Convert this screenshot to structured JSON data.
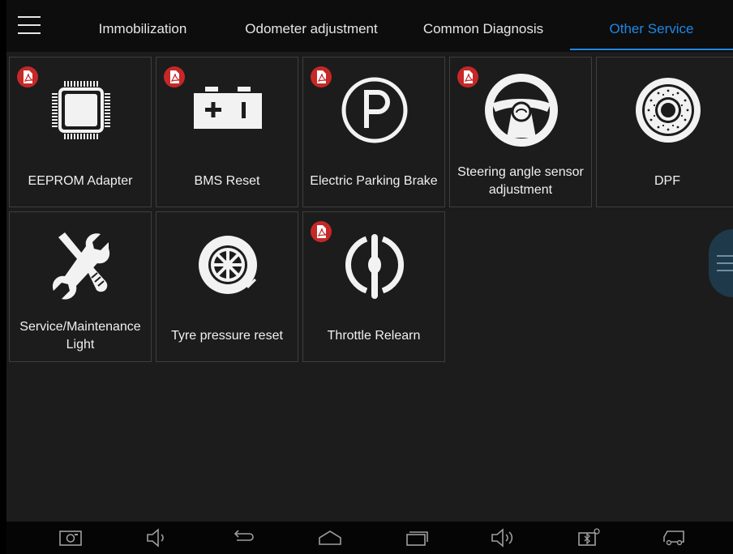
{
  "tabs": [
    {
      "label": "Immobilization",
      "active": false
    },
    {
      "label": "Odometer adjustment",
      "active": false
    },
    {
      "label": "Common Diagnosis",
      "active": false
    },
    {
      "label": "Other Service",
      "active": true
    }
  ],
  "colors": {
    "accent": "#1e88e5",
    "background": "#1c1c1c",
    "tile_border": "#3e3e3e",
    "pdf_badge": "#c62828"
  },
  "tiles": [
    {
      "label": "EEPROM Adapter",
      "icon": "chip-icon",
      "has_pdf": true
    },
    {
      "label": "BMS Reset",
      "icon": "battery-icon",
      "has_pdf": true
    },
    {
      "label": "Electric Parking Brake",
      "icon": "parking-brake-icon",
      "has_pdf": true
    },
    {
      "label": "Steering angle sensor adjustment",
      "icon": "steering-wheel-icon",
      "has_pdf": true
    },
    {
      "label": "DPF",
      "icon": "dpf-filter-icon",
      "has_pdf": false
    },
    {
      "label": "Service/Maintenance Light",
      "icon": "wrench-screwdriver-icon",
      "has_pdf": false
    },
    {
      "label": "Tyre pressure reset",
      "icon": "tyre-icon",
      "has_pdf": false
    },
    {
      "label": "Throttle Relearn",
      "icon": "throttle-icon",
      "has_pdf": true
    }
  ],
  "navbar": [
    "screenshot-icon",
    "volume-down-icon",
    "back-icon",
    "home-icon",
    "recent-apps-icon",
    "volume-up-icon",
    "vci-bluetooth-icon",
    "vehicle-icon"
  ]
}
